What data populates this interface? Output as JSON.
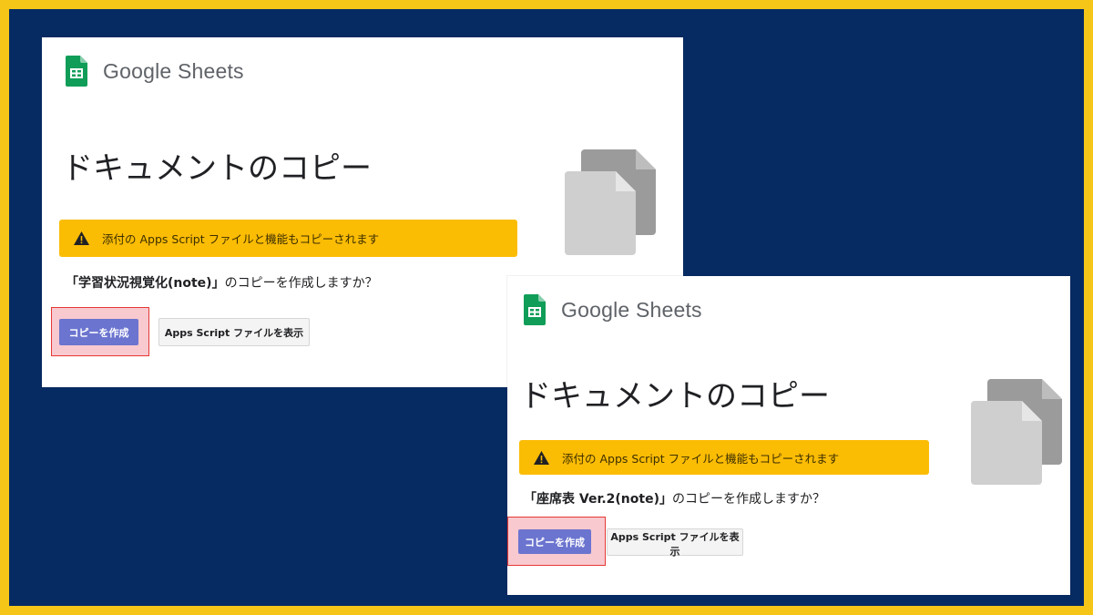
{
  "colors": {
    "background": "#062b63",
    "frame_border": "#f5c518",
    "warning_bg": "#fbbc04",
    "primary_button": "#6b74cf",
    "highlight_border": "#e53935",
    "sheets_green": "#0f9d58"
  },
  "dialogs": [
    {
      "brand": "Google Sheets",
      "title": "ドキュメントのコピー",
      "warning_icon": "warning-icon",
      "warning_text": "添付の Apps Script ファイルと機能もコピーされます",
      "doc_name": "「学習状況視覚化(note)」",
      "question_suffix": "のコピーを作成しますか？",
      "copy_button": "コピーを作成",
      "view_script_button": "Apps Script ファイルを表示"
    },
    {
      "brand": "Google Sheets",
      "title": "ドキュメントのコピー",
      "warning_icon": "warning-icon",
      "warning_text": "添付の Apps Script ファイルと機能もコピーされます",
      "doc_name": "「座席表 Ver.2(note)」",
      "question_suffix": "のコピーを作成しますか？",
      "copy_button": "コピーを作成",
      "view_script_button": "Apps Script ファイルを表示"
    }
  ]
}
